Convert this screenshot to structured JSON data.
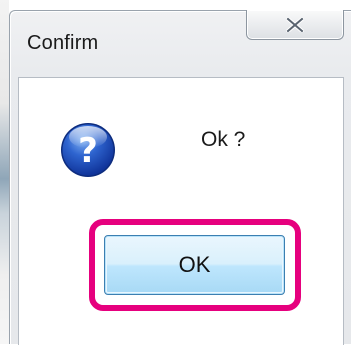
{
  "dialog": {
    "title": "Confirm",
    "message": "Ok ?",
    "icon": "question-icon",
    "ok_label": "OK",
    "close_icon": "close-icon"
  },
  "colors": {
    "highlight": "#e6007e",
    "button_border": "#3c7fb1",
    "icon_blue": "#1f4fb5"
  }
}
